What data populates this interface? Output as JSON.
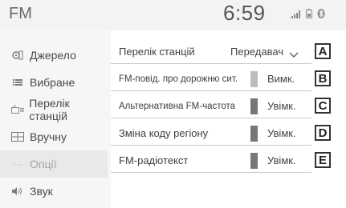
{
  "header": {
    "title": "FM",
    "clock": "6:59",
    "status_icons": [
      "signal-bars-icon",
      "phone-battery-icon",
      "bluetooth-icon"
    ]
  },
  "sidebar": {
    "items": [
      {
        "label": "Джерело",
        "icon": "source-icon"
      },
      {
        "label": "Вибране",
        "icon": "favorites-icon"
      },
      {
        "label": "Перелік станцій",
        "icon": "station-list-icon"
      },
      {
        "label": "Вручну",
        "icon": "manual-tune-icon"
      },
      {
        "label": "Опції",
        "icon": "options-dots-icon",
        "active": true
      },
      {
        "label": "Звук",
        "icon": "speaker-icon"
      }
    ]
  },
  "options": {
    "rows": [
      {
        "label": "Перелік станцій",
        "control": "dropdown",
        "value": "Передавач",
        "callout": "A"
      },
      {
        "label": "FM-повід. про дорожню сит.",
        "control": "toggle",
        "value": "Вимк.",
        "on": false,
        "callout": "B"
      },
      {
        "label": "Альтернативна FM-частота",
        "control": "toggle",
        "value": "Увімк.",
        "on": true,
        "callout": "C"
      },
      {
        "label": "Зміна коду регіону",
        "control": "toggle",
        "value": "Увімк.",
        "on": true,
        "callout": "D"
      },
      {
        "label": "FM-радіотекст",
        "control": "toggle",
        "value": "Увімк.",
        "on": true,
        "callout": "E"
      }
    ]
  },
  "colors": {
    "toggle_on": "#777777",
    "toggle_off": "#bdbdbd",
    "active_sidebar_bg": "#e9e9e9"
  }
}
